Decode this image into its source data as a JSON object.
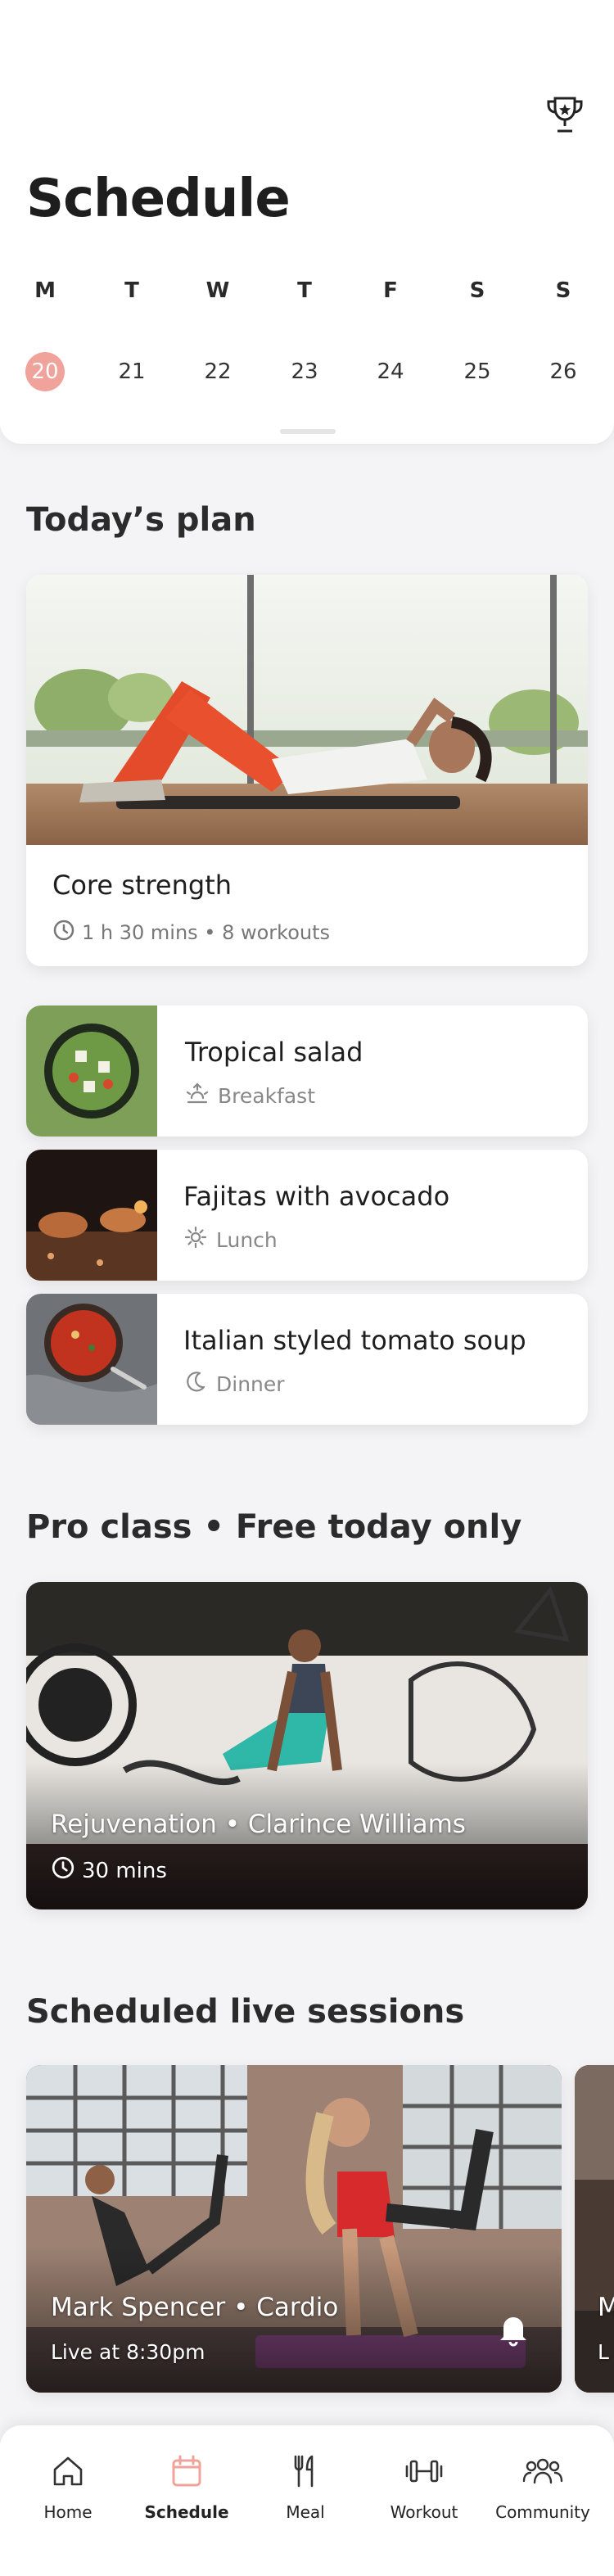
{
  "header": {
    "title": "Schedule",
    "trophy_icon": "trophy-icon",
    "weekdays": [
      "M",
      "T",
      "W",
      "T",
      "F",
      "S",
      "S"
    ],
    "dates": [
      "20",
      "21",
      "22",
      "23",
      "24",
      "25",
      "26"
    ],
    "selected_date": "20"
  },
  "today": {
    "section_title": "Today’s plan",
    "workout": {
      "title": "Core strength",
      "meta": "1 h 30 mins • 8 workouts"
    },
    "meals": [
      {
        "name": "Tropical salad",
        "type": "Breakfast",
        "icon": "sunrise-icon"
      },
      {
        "name": "Fajitas with avocado",
        "type": "Lunch",
        "icon": "sun-icon"
      },
      {
        "name": "Italian styled tomato soup",
        "type": "Dinner",
        "icon": "moon-icon"
      }
    ]
  },
  "pro": {
    "section_title": "Pro class • Free today only",
    "class_title": "Rejuvenation • Clarince Williams",
    "duration": "30 mins"
  },
  "live": {
    "section_title": "Scheduled live sessions",
    "sessions": [
      {
        "title": "Mark Spencer • Cardio",
        "time": "Live at 8:30pm"
      },
      {
        "title": "M",
        "time": "L"
      }
    ]
  },
  "nav": {
    "items": [
      {
        "label": "Home",
        "icon": "home-icon"
      },
      {
        "label": "Schedule",
        "icon": "calendar-icon"
      },
      {
        "label": "Meal",
        "icon": "cutlery-icon"
      },
      {
        "label": "Workout",
        "icon": "dumbbell-icon"
      },
      {
        "label": "Community",
        "icon": "community-icon"
      }
    ],
    "active": "Schedule"
  },
  "colors": {
    "accent": "#f0a39a",
    "background": "#f4f4f6",
    "card": "#ffffff"
  }
}
